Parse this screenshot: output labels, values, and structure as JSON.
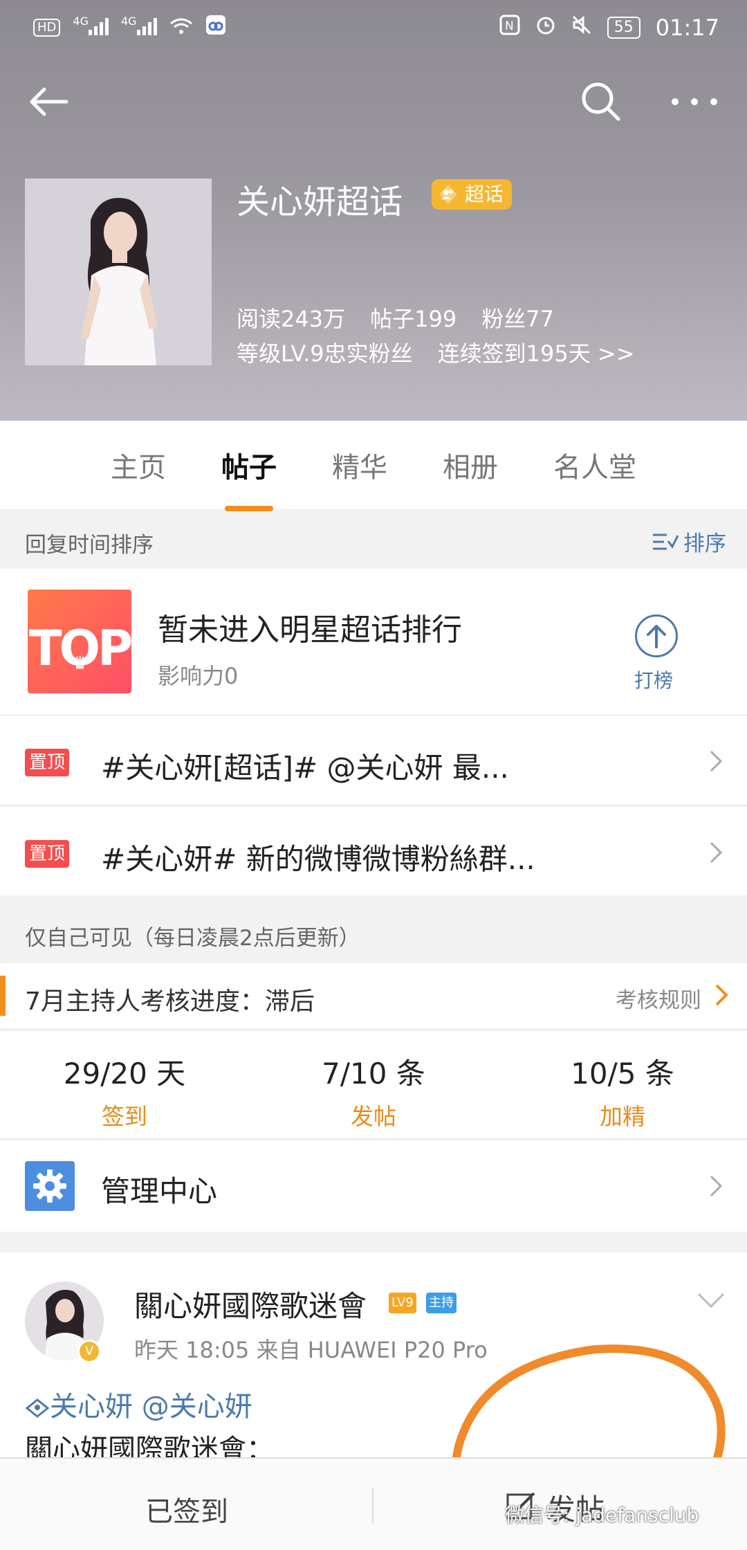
{
  "status_bar": {
    "left_icons": [
      "HD",
      "4G",
      "4G"
    ],
    "battery": "55",
    "time": "01:17"
  },
  "header": {
    "title": "关心妍超话",
    "badge": "超话",
    "stats_line1": [
      "阅读243万",
      "帖子199",
      "粉丝77"
    ],
    "stats_line2": [
      "等级LV.9忠实粉丝",
      "连续签到195天 >>"
    ]
  },
  "tabs": [
    "主页",
    "帖子",
    "精华",
    "相册",
    "名人堂"
  ],
  "active_tab": "帖子",
  "sort": {
    "label": "回复时间排序",
    "button": "排序"
  },
  "ranking": {
    "logo": "TOP",
    "title": "暂未进入明星超话排行",
    "influence": "影响力0",
    "action": "打榜"
  },
  "pinned": [
    {
      "tag": "置顶",
      "text": "#关心妍[超话]#  @关心妍  最..."
    },
    {
      "tag": "置顶",
      "text": "#关心妍# 新的微博微博粉絲群..."
    }
  ],
  "private_note": "仅自己可见（每日凌晨2点后更新）",
  "assessment": {
    "title": "7月主持人考核进度：滞后",
    "rules": "考核规则"
  },
  "metrics": [
    {
      "value": "29/20 天",
      "label": "签到"
    },
    {
      "value": "7/10 条",
      "label": "发帖"
    },
    {
      "value": "10/5 条",
      "label": "加精"
    }
  ],
  "manage": {
    "label": "管理中心"
  },
  "post": {
    "author": "關心妍國際歌迷會",
    "level_badge": "LV9",
    "role_badge": "主持",
    "meta": "昨天 18:05   来自 HUAWEI P20 Pro",
    "tags": "关心妍 @关心妍",
    "body": "關心妍國際歌迷會："
  },
  "bottom": {
    "signed": "已签到",
    "post": "发帖",
    "watermark": "微信号: jadefansclub"
  },
  "colors": {
    "accent_orange": "#f28f1c",
    "link_blue": "#4c79b0",
    "pin_red": "#f44d4d"
  }
}
